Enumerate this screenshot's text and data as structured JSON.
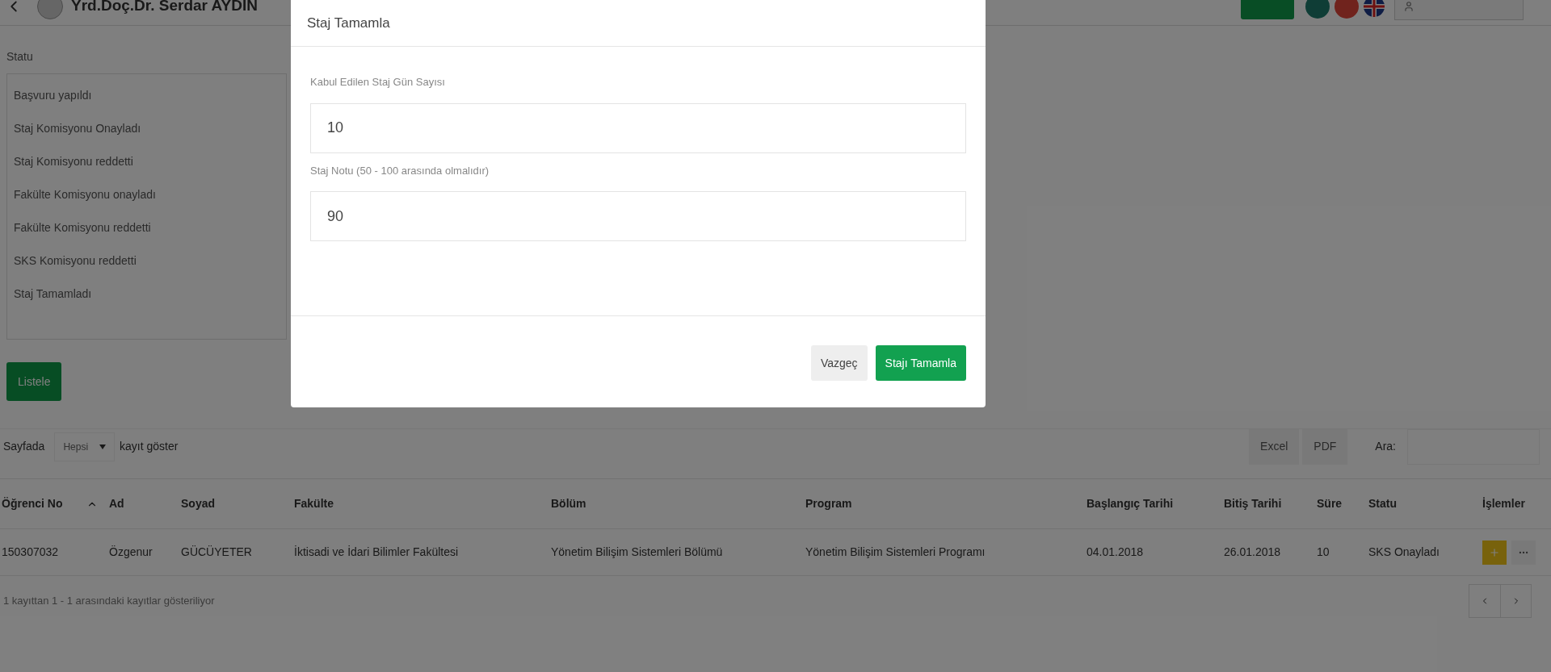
{
  "header": {
    "user_name": "Yrd.Doç.Dr. Serdar AYDIN"
  },
  "filter": {
    "label": "Statu",
    "options": [
      "Başvuru yapıldı",
      "Staj Komisyonu Onayladı",
      "Staj Komisyonu reddetti",
      "Fakülte Komisyonu onayladı",
      "Fakülte Komisyonu reddetti",
      "SKS Komisyonu reddetti",
      "Staj Tamamladı"
    ],
    "button": "Listele"
  },
  "table_controls": {
    "page_size_prefix": "Sayfada",
    "page_size": "Hepsi",
    "page_size_suffix": "kayıt göster",
    "exports": [
      "Excel",
      "PDF"
    ],
    "search_label": "Ara:"
  },
  "table": {
    "columns": [
      {
        "label": "Öğrenci No",
        "sorted": true
      },
      {
        "label": "Ad",
        "sorted": false
      },
      {
        "label": "Soyad",
        "sorted": false
      },
      {
        "label": "Fakülte",
        "sorted": false
      },
      {
        "label": "Bölüm",
        "sorted": false
      },
      {
        "label": "Program",
        "sorted": false
      },
      {
        "label": "Başlangıç Tarihi",
        "sorted": false
      },
      {
        "label": "Bitiş Tarihi",
        "sorted": false
      },
      {
        "label": "Süre",
        "sorted": false
      },
      {
        "label": "Statu",
        "sorted": false
      },
      {
        "label": "İşlemler",
        "sorted": false
      }
    ],
    "rows": [
      {
        "cells": [
          "150307032",
          "Özgenur",
          "GÜCÜYETER",
          "İktisadi ve İdari Bilimler Fakültesi",
          "Yönetim Bilişim Sistemleri Bölümü",
          "Yönetim Bilişim Sistemleri Programı",
          "04.01.2018",
          "26.01.2018",
          "10",
          "SKS Onayladı"
        ]
      }
    ]
  },
  "info": "1 kayıttan 1 - 1 arasındaki kayıtlar gösteriliyor",
  "modal": {
    "title": "Staj Tamamla",
    "fields": [
      {
        "label": "Kabul Edilen Staj Gün Sayısı",
        "value": "10"
      },
      {
        "label": "Staj Notu (50 - 100 arasında olmalıdır)",
        "value": "90"
      }
    ],
    "buttons": [
      {
        "label": "Vazgeç",
        "kind": "secondary"
      },
      {
        "label": "Stajı Tamamla",
        "kind": "primary"
      }
    ]
  }
}
